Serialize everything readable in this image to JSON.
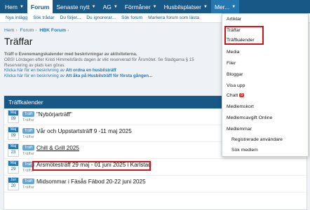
{
  "nav": {
    "items": [
      {
        "label": "Hem",
        "caret": true
      },
      {
        "label": "Forum",
        "caret": false
      },
      {
        "label": "Senaste nytt",
        "caret": true
      },
      {
        "label": "AG",
        "caret": true
      },
      {
        "label": "Förmåner",
        "caret": true
      },
      {
        "label": "Husbilsplatser",
        "caret": true
      },
      {
        "label": "Mer...",
        "caret": true
      }
    ]
  },
  "subnav": {
    "items": [
      "Nya inlägg",
      "Sök trådar",
      "Du följer...",
      "Du ignorerar...",
      "Sök forum",
      "Markera forum som lästa"
    ]
  },
  "breadcrumb": {
    "home": "Hem",
    "forum": "Forum",
    "current": "HBK Forum"
  },
  "page": {
    "title": "Träffar",
    "desc_line1": "Träff o Evenemangskalender med beskrivningar av aktiviteterna.",
    "desc_line2": "OBS! Lördagen efter Kristi Himmelsfärds dagen är vikt reserverad för Årsmötet. Se Stadgarna § 15",
    "desc_line3": "Reservering av plats kan göras.",
    "link1_pre": "Klicka här för en beskrivning av ",
    "link1_strong": "Att ordna en husbilsträff",
    "link2_pre": "Klicka här för en beskrivning av ",
    "link2_strong": "Att åka på Husbilsträff för första gången..."
  },
  "calendar": {
    "header": "Träffkalender",
    "tag": "Träff",
    "events": [
      {
        "month": "Maj",
        "day": "09",
        "title": "\"Nybörjarträff\"",
        "sub": "Träffar"
      },
      {
        "month": "Maj",
        "day": "09",
        "title": "Vår och Uppstartsträff 9 -11 maj 2025",
        "sub": "Träffar"
      },
      {
        "month": "Maj",
        "day": "23",
        "title": "Chill & Grill 2025",
        "sub": "Träffar"
      },
      {
        "month": "Maj",
        "day": "29",
        "title": "Årsmötesträff 29 maj - 01 juni 2025 i Karlstad",
        "sub": "Träffar"
      },
      {
        "month": "Jun",
        "day": "20",
        "title": "Midsommar i Fäsås Fäbod 20-22 juni 2025",
        "sub": "Träffar"
      }
    ]
  },
  "dropdown": {
    "items": [
      {
        "label": "Artiklar"
      },
      {
        "label": "Träffar"
      },
      {
        "label": "Träffkalender"
      },
      {
        "label": "Media"
      },
      {
        "label": "Filer"
      },
      {
        "label": "Bloggar"
      },
      {
        "label": "Visa upp"
      },
      {
        "label": "Chatt",
        "badge": "0"
      },
      {
        "label": "Medlemskort"
      },
      {
        "label": "Medlemsavgift Online"
      },
      {
        "label": "Medlemmar"
      },
      {
        "label": "Registrerade användare"
      },
      {
        "label": "Sök medlem"
      }
    ]
  },
  "colors": {
    "primary": "#185886",
    "accent": "#2577b1",
    "highlight": "#d0121b"
  }
}
